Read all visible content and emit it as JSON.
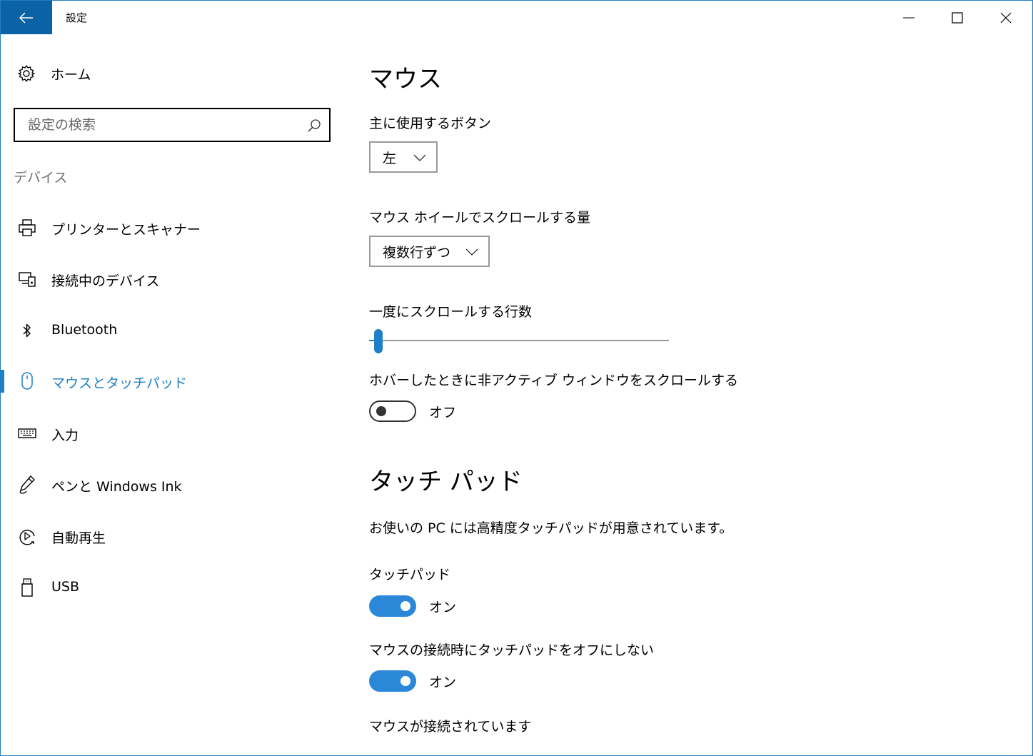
{
  "window": {
    "title": "設定",
    "controls": {
      "minimize": "minimize-icon",
      "maximize": "maximize-icon",
      "close": "close-icon"
    }
  },
  "sidebar": {
    "home_label": "ホーム",
    "search_placeholder": "設定の検索",
    "section_title": "デバイス",
    "items": [
      {
        "label": "プリンターとスキャナー",
        "icon": "printer-icon",
        "active": false
      },
      {
        "label": "接続中のデバイス",
        "icon": "connected-devices-icon",
        "active": false
      },
      {
        "label": "Bluetooth",
        "icon": "bluetooth-icon",
        "active": false
      },
      {
        "label": "マウスとタッチパッド",
        "icon": "mouse-icon",
        "active": true
      },
      {
        "label": "入力",
        "icon": "keyboard-icon",
        "active": false
      },
      {
        "label": "ペンと Windows Ink",
        "icon": "pen-icon",
        "active": false
      },
      {
        "label": "自動再生",
        "icon": "autoplay-icon",
        "active": false
      },
      {
        "label": "USB",
        "icon": "usb-icon",
        "active": false
      }
    ]
  },
  "main": {
    "mouse_title": "マウス",
    "primary_button_label": "主に使用するボタン",
    "primary_button_value": "左",
    "wheel_scroll_label": "マウス ホイールでスクロールする量",
    "wheel_scroll_value": "複数行ずつ",
    "lines_label": "一度にスクロールする行数",
    "lines_slider_fraction": 0.03,
    "hover_scroll_label": "ホバーしたときに非アクティブ ウィンドウをスクロールする",
    "hover_scroll_state": "オフ",
    "touchpad_title": "タッチ パッド",
    "precision_note": "お使いの PC には高精度タッチパッドが用意されています。",
    "touchpad_label": "タッチパッド",
    "touchpad_state": "オン",
    "keep_on_label": "マウスの接続時にタッチパッドをオフにしない",
    "keep_on_state": "オン",
    "mouse_connected_label": "マウスが接続されています"
  },
  "colors": {
    "accent": "#1f7fc6",
    "title_back": "#0b63a6",
    "toggle_on": "#2b88d8"
  }
}
